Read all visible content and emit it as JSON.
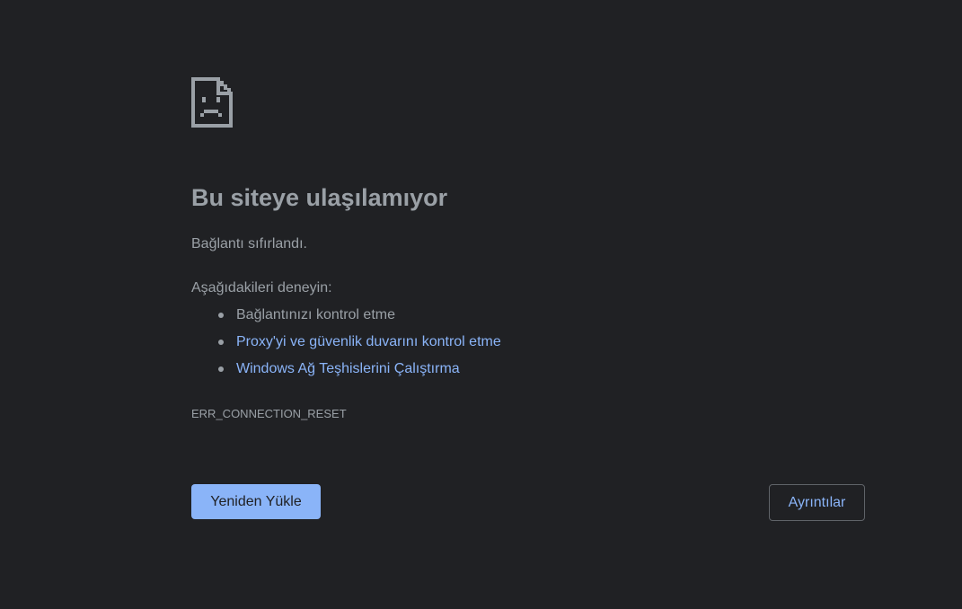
{
  "error_page": {
    "icon": "sad-document-icon",
    "title": "Bu siteye ulaşılamıyor",
    "summary": "Bağlantı sıfırlandı.",
    "suggestions_heading": "Aşağıdakileri deneyin:",
    "suggestions": [
      {
        "label": "Bağlantınızı kontrol etme",
        "is_link": false
      },
      {
        "label": "Proxy'yi ve güvenlik duvarını kontrol etme",
        "is_link": true
      },
      {
        "label": "Windows Ağ Teşhislerini Çalıştırma",
        "is_link": true
      }
    ],
    "error_code": "ERR_CONNECTION_RESET",
    "reload_button": "Yeniden Yükle",
    "details_button": "Ayrıntılar"
  },
  "colors": {
    "background": "#202124",
    "text": "#9aa0a6",
    "link": "#8ab4f8",
    "primary_button_bg": "#8ab4f8",
    "primary_button_text": "#202124",
    "secondary_button_border": "#5f6368"
  }
}
